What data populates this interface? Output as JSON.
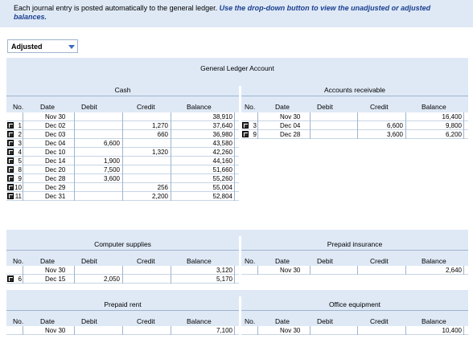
{
  "instructions": {
    "text": "Each journal entry is posted automatically to the general ledger. ",
    "emphasis": "Use the drop-down button to view the unadjusted or adjusted balances."
  },
  "view_select": {
    "selected": "Adjusted"
  },
  "ledger_title": "General Ledger Account",
  "col_labels": {
    "no": "No.",
    "date": "Date",
    "debit": "Debit",
    "credit": "Credit",
    "balance": "Balance"
  },
  "accounts": {
    "cash": {
      "title": "Cash",
      "rows": [
        {
          "no": "",
          "date": "Nov 30",
          "debit": "",
          "credit": "",
          "balance": "38,910"
        },
        {
          "no": "1",
          "date": "Dec 02",
          "debit": "",
          "credit": "1,270",
          "balance": "37,640"
        },
        {
          "no": "2",
          "date": "Dec 03",
          "debit": "",
          "credit": "660",
          "balance": "36,980"
        },
        {
          "no": "3",
          "date": "Dec 04",
          "debit": "6,600",
          "credit": "",
          "balance": "43,580"
        },
        {
          "no": "4",
          "date": "Dec 10",
          "debit": "",
          "credit": "1,320",
          "balance": "42,260"
        },
        {
          "no": "5",
          "date": "Dec 14",
          "debit": "1,900",
          "credit": "",
          "balance": "44,160"
        },
        {
          "no": "8",
          "date": "Dec 20",
          "debit": "7,500",
          "credit": "",
          "balance": "51,660"
        },
        {
          "no": "9",
          "date": "Dec 28",
          "debit": "3,600",
          "credit": "",
          "balance": "55,260"
        },
        {
          "no": "10",
          "date": "Dec 29",
          "debit": "",
          "credit": "256",
          "balance": "55,004"
        },
        {
          "no": "11",
          "date": "Dec 31",
          "debit": "",
          "credit": "2,200",
          "balance": "52,804"
        }
      ]
    },
    "accounts_receivable": {
      "title": "Accounts receivable",
      "rows": [
        {
          "no": "",
          "date": "Nov 30",
          "debit": "",
          "credit": "",
          "balance": "16,400"
        },
        {
          "no": "3",
          "date": "Dec 04",
          "debit": "",
          "credit": "6,600",
          "balance": "9,800"
        },
        {
          "no": "9",
          "date": "Dec 28",
          "debit": "",
          "credit": "3,600",
          "balance": "6,200"
        }
      ]
    },
    "computer_supplies": {
      "title": "Computer supplies",
      "rows": [
        {
          "no": "",
          "date": "Nov 30",
          "debit": "",
          "credit": "",
          "balance": "3,120"
        },
        {
          "no": "6",
          "date": "Dec 15",
          "debit": "2,050",
          "credit": "",
          "balance": "5,170"
        }
      ]
    },
    "prepaid_insurance": {
      "title": "Prepaid insurance",
      "rows": [
        {
          "no": "",
          "date": "Nov 30",
          "debit": "",
          "credit": "",
          "balance": "2,640"
        }
      ]
    },
    "prepaid_rent": {
      "title": "Prepaid rent",
      "rows": [
        {
          "no": "",
          "date": "Nov 30",
          "debit": "",
          "credit": "",
          "balance": "7,100"
        }
      ]
    },
    "office_equipment": {
      "title": "Office equipment",
      "rows": [
        {
          "no": "",
          "date": "Nov 30",
          "debit": "",
          "credit": "",
          "balance": "10,400"
        }
      ]
    }
  }
}
